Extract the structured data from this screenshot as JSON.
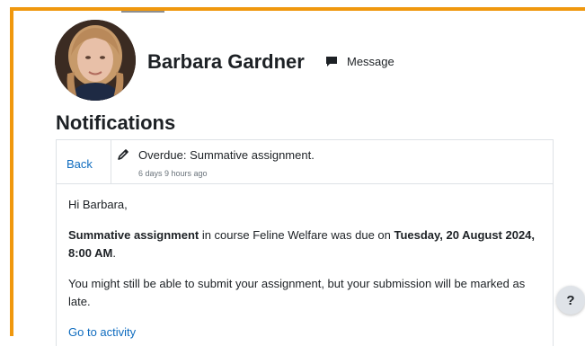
{
  "profile": {
    "name": "Barbara Gardner",
    "message_label": "Message",
    "avatar_icon": "profile-photo"
  },
  "page": {
    "title": "Notifications"
  },
  "notification": {
    "back_label": "Back",
    "icon": "assignment-icon",
    "subject": "Overdue: Summative assignment.",
    "time_ago": "6 days 9 hours ago",
    "greeting": "Hi Barbara,",
    "assignment_name": "Summative assignment",
    "course_text": " in course Feline Welfare was due on ",
    "due_date": "Tuesday, 20 August 2024, 8:00 AM",
    "due_suffix": ".",
    "late_text": "You might still be able to submit your assignment, but your submission will be marked as late.",
    "activity_link": "Go to activity"
  },
  "help": {
    "label": "?"
  },
  "colors": {
    "accent_frame": "#f0980e",
    "link": "#0f6cbf",
    "text": "#1d2125"
  }
}
